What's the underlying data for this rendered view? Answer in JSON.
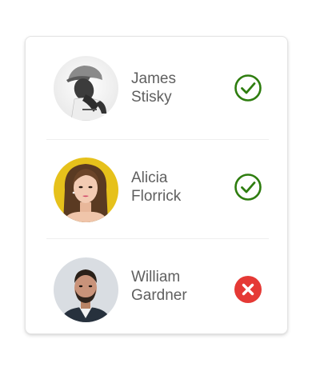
{
  "users": [
    {
      "first_name": "James",
      "last_name": "Stisky",
      "status": "check-icon",
      "status_color": "#2e7d0f"
    },
    {
      "first_name": "Alicia",
      "last_name": "Florrick",
      "status": "check-icon",
      "status_color": "#2e7d0f"
    },
    {
      "first_name": "William",
      "last_name": "Gardner",
      "status": "cross-icon",
      "status_color": "#e53935"
    }
  ]
}
